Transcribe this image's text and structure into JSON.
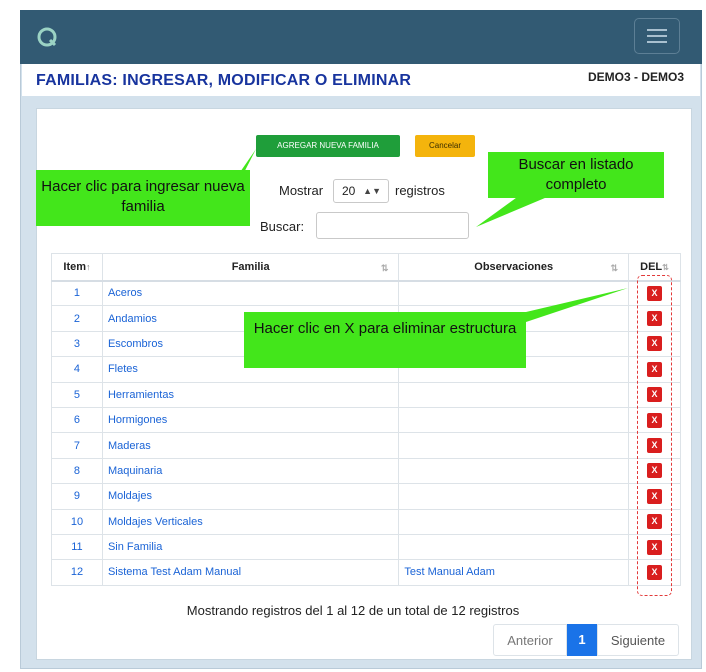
{
  "header": {
    "title": "FAMILIAS: INGRESAR, MODIFICAR O ELIMINAR",
    "user": "DEMO3 - DEMO3"
  },
  "toolbar": {
    "add_label": "AGREGAR NUEVA FAMILIA",
    "cancel_label": "Cancelar"
  },
  "controls": {
    "show_label": "Mostrar",
    "page_size": "20",
    "records_label": "registros",
    "search_label": "Buscar:",
    "search_value": ""
  },
  "table": {
    "columns": [
      "Item",
      "Familia",
      "Observaciones",
      "DEL"
    ],
    "rows": [
      {
        "item": "1",
        "familia": "Aceros",
        "obs": "",
        "del": "X"
      },
      {
        "item": "2",
        "familia": "Andamios",
        "obs": "",
        "del": "X"
      },
      {
        "item": "3",
        "familia": "Escombros",
        "obs": "",
        "del": "X"
      },
      {
        "item": "4",
        "familia": "Fletes",
        "obs": "",
        "del": "X"
      },
      {
        "item": "5",
        "familia": "Herramientas",
        "obs": "",
        "del": "X"
      },
      {
        "item": "6",
        "familia": "Hormigones",
        "obs": "",
        "del": "X"
      },
      {
        "item": "7",
        "familia": "Maderas",
        "obs": "",
        "del": "X"
      },
      {
        "item": "8",
        "familia": "Maquinaria",
        "obs": "",
        "del": "X"
      },
      {
        "item": "9",
        "familia": "Moldajes",
        "obs": "",
        "del": "X"
      },
      {
        "item": "10",
        "familia": "Moldajes Verticales",
        "obs": "",
        "del": "X"
      },
      {
        "item": "11",
        "familia": "Sin Familia",
        "obs": "",
        "del": "X"
      },
      {
        "item": "12",
        "familia": "Sistema Test Adam Manual",
        "obs": "Test Manual Adam",
        "del": "X"
      }
    ]
  },
  "footer": {
    "info": "Mostrando registros del 1 al 12 de un total de 12 registros",
    "prev": "Anterior",
    "page": "1",
    "next": "Siguiente"
  },
  "callouts": {
    "add": "Hacer clic para ingresar nueva familia",
    "search": "Buscar en listado completo",
    "delete": "Hacer clic en  X  para eliminar estructura"
  },
  "icons": {
    "logo": "logo-icon",
    "menu": "hamburger-menu-icon",
    "sort": "sort-icon",
    "select": "select-arrow-icon"
  },
  "colors": {
    "topbar": "#325a73",
    "title": "#18349e",
    "add_button": "#1f9e3a",
    "cancel_button": "#f4b40c",
    "delete_button": "#d91e1e",
    "link": "#1a63d6",
    "callout": "#43e61b",
    "active_page": "#1a73e8"
  }
}
